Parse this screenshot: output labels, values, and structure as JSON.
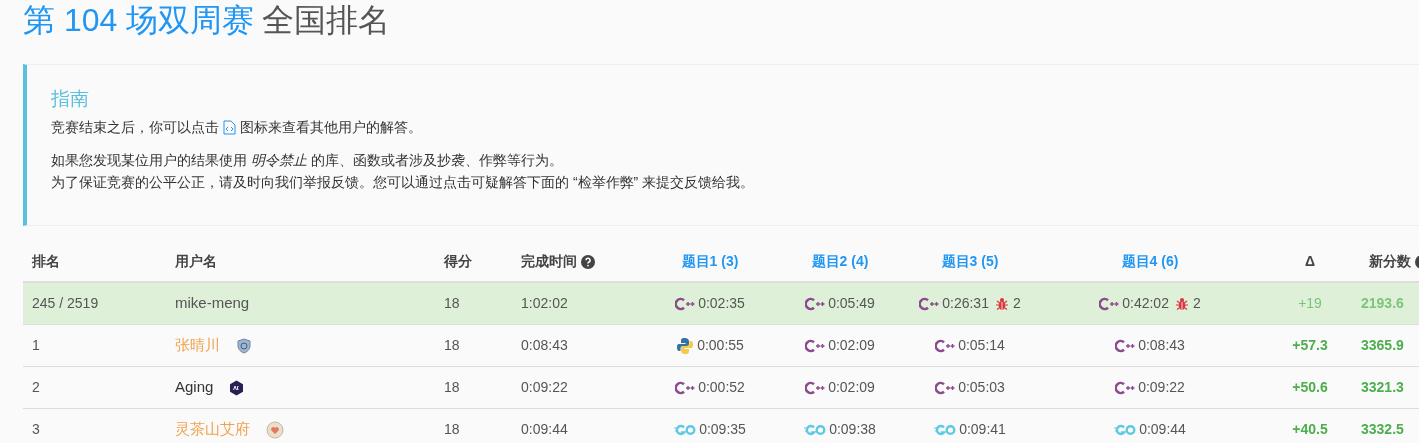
{
  "title": {
    "highlight": "第 104 场双周赛",
    "rest": "全国排名"
  },
  "guide": {
    "heading": "指南",
    "line1_before": "竞赛结束之后，你可以点击",
    "line1_after": "图标来查看其他用户的解答。",
    "lines": [
      "如果您发现某位用户的结果使用 *明令禁止* 的库、函数或者涉及抄袭、作弊等行为。",
      "为了保证竞赛的公平公正，请及时向我们举报反馈。您可以通过点击可疑解答下面的 “检举作弊” 来提交反馈给我。"
    ]
  },
  "table": {
    "columns": [
      {
        "label": "排名",
        "kind": "plain"
      },
      {
        "label": "用户名",
        "kind": "plain"
      },
      {
        "label": "得分",
        "kind": "plain"
      },
      {
        "label": "完成时间",
        "kind": "help"
      },
      {
        "label": "题目1 (3)",
        "kind": "problem"
      },
      {
        "label": "题目2 (4)",
        "kind": "problem"
      },
      {
        "label": "题目3 (5)",
        "kind": "problem"
      },
      {
        "label": "题目4 (6)",
        "kind": "problem"
      },
      {
        "label": "Δ",
        "kind": "center"
      },
      {
        "label": "新分数",
        "kind": "help"
      }
    ],
    "rows": [
      {
        "selected": true,
        "rank": "245 / 2519",
        "user": "mike-meng",
        "color": "#555555",
        "score": "18",
        "time": "1:02:02",
        "problems": [
          {
            "kind": "cpp",
            "time": "0:02:35"
          },
          {
            "kind": "cpp",
            "time": "0:05:49"
          },
          {
            "kind": "cpp",
            "time": "0:26:31",
            "wrong": "2"
          },
          {
            "kind": "cpp",
            "time": "0:42:02",
            "wrong": "2"
          }
        ],
        "delta": "+19",
        "rating": "2193.6"
      },
      {
        "selected": false,
        "rank": "1",
        "user": "张晴川",
        "color": "#f0a24f",
        "badge": {
          "kind": "shield"
        },
        "score": "18",
        "time": "0:08:43",
        "problems": [
          {
            "kind": "python",
            "time": "0:00:55"
          },
          {
            "kind": "cpp",
            "time": "0:02:09"
          },
          {
            "kind": "cpp",
            "time": "0:05:14"
          },
          {
            "kind": "cpp",
            "time": "0:08:43"
          }
        ],
        "delta": "+57.3",
        "rating": "3365.9"
      },
      {
        "selected": false,
        "rank": "2",
        "user": "Aging",
        "color": "#333333",
        "badge": {
          "kind": "hexagon"
        },
        "score": "18",
        "time": "0:09:22",
        "problems": [
          {
            "kind": "cpp",
            "time": "0:00:52"
          },
          {
            "kind": "cpp",
            "time": "0:02:09"
          },
          {
            "kind": "cpp",
            "time": "0:05:03"
          },
          {
            "kind": "cpp",
            "time": "0:09:22"
          }
        ],
        "delta": "+50.6",
        "rating": "3321.3"
      },
      {
        "selected": false,
        "rank": "3",
        "user": "灵茶山艾府",
        "color": "#f0a24f",
        "badge": {
          "kind": "round"
        },
        "score": "18",
        "time": "0:09:44",
        "problems": [
          {
            "kind": "go",
            "time": "0:09:35"
          },
          {
            "kind": "go",
            "time": "0:09:38"
          },
          {
            "kind": "go",
            "time": "0:09:41"
          },
          {
            "kind": "go",
            "time": "0:09:44"
          }
        ],
        "delta": "+40.5",
        "rating": "3332.5"
      }
    ]
  }
}
